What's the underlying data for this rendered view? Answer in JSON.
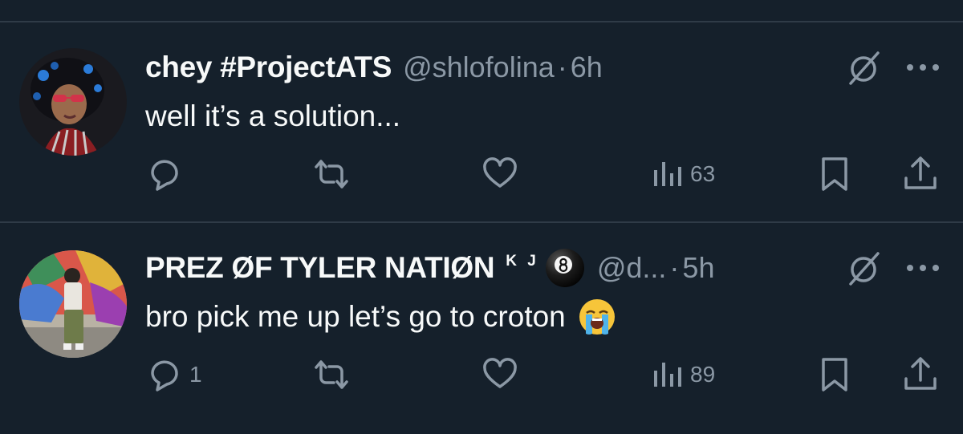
{
  "tweets": [
    {
      "display_name": "chey #ProjectATS",
      "handle": "@shlofolina",
      "separator": "·",
      "time": "6h",
      "text": "well it’s a solution...",
      "actions": {
        "reply_count": "",
        "retweet_count": "",
        "like_count": "",
        "views_count": "63"
      },
      "icons": [
        "avatar",
        "grok-icon",
        "more-icon",
        "reply-icon",
        "retweet-icon",
        "like-icon",
        "views-icon",
        "bookmark-icon",
        "share-icon"
      ]
    },
    {
      "display_name": "PREZ ØF TYLER NATIØN",
      "name_suffix": "K J",
      "name_emoji": "8-ball-emoji",
      "handle": "@d...",
      "separator": "·",
      "time": "5h",
      "text": "bro pick me up let’s go to croton",
      "text_emoji": "loudly-crying-face-emoji",
      "actions": {
        "reply_count": "1",
        "retweet_count": "",
        "like_count": "",
        "views_count": "89"
      }
    }
  ],
  "colors": {
    "background": "#15202b",
    "divider": "#2f3b47",
    "primary_text": "#f7f9f9",
    "secondary_text": "#8b98a5"
  }
}
